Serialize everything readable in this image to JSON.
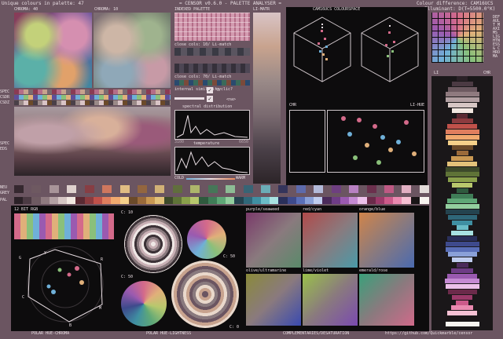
{
  "header": {
    "unique_colours": "Unique colours in palette: 47",
    "title": "= CENSOR v0.6.0 - PALETTE ANALYSER =",
    "colour_difference": "Colour difference: CAM16UCS",
    "illuminant": "Illuminant: D(T=5500.0°K)"
  },
  "top_left": {
    "chroma_40": "CHROMA: 40",
    "chroma_10": "CHROMA: 10"
  },
  "indexed_palette": {
    "title": "INDEXED PALETTE",
    "close_cols_10": "close cols: 10/ Li-match",
    "close_cols_70": "close cols: 70/ Li-match",
    "internal_similarity": "internal similarity",
    "cyclic": "cyclic?",
    "na": "<na>",
    "spectral": "spectral distribution",
    "spectral_min": "3100",
    "spectral_max": "6650",
    "temperature": "temperature",
    "cold": "COLD",
    "warm": "WARM"
  },
  "li_matr": "LI-MATR",
  "cam16": {
    "title": "CAM16UCS COLOURSPACE",
    "chr": "CHR",
    "li_hue": "LI-HUE"
  },
  "right": {
    "li": "LI",
    "chr": "CHR",
    "side_text": "DEFAULT MAXIMS LIGHTNESS & CHROMA"
  },
  "spec_labels": [
    "SPEC",
    "CSDR",
    "CSDZ",
    "SPEC",
    "EDS"
  ],
  "neu": "NEU",
  "grey": "GREY",
  "pal": "PAL",
  "bit12": "12 BIT RGB",
  "polar": {
    "c10": "C: 10",
    "c50a": "C: 50",
    "c50b": "C: 50",
    "c0": "C: 0",
    "letters": [
      "G",
      "Y",
      "R",
      "C",
      "B",
      "M"
    ]
  },
  "complements": [
    "purple/seaweed",
    "red/cyan",
    "orange/blue",
    "olive/ultramarine",
    "lime/violet",
    "emerald/rose"
  ],
  "footer": {
    "polar_hue_chroma": "POLAR HUE-CHROMA",
    "polar_hue_lightness": "POLAR HUE-LIGHTNESS",
    "complementaries": "COMPLEMENTARIES/DESATURATION",
    "url": "https://github.com/Quickmarble/censor"
  },
  "palette_colors": [
    "#2b2127",
    "#4b3a43",
    "#6e5a61",
    "#8f7a7f",
    "#b3a0a3",
    "#d6c6c4",
    "#f2e8e1",
    "#5a2a33",
    "#8c3b3f",
    "#c0514a",
    "#e07e5e",
    "#f1a96e",
    "#f5d08a",
    "#6b4a2a",
    "#9a6a3a",
    "#c99853",
    "#e3c27a",
    "#3d4a2a",
    "#5f7337",
    "#8aa04b",
    "#b8c86d",
    "#2f5a3e",
    "#3f7d57",
    "#5fa877",
    "#93cf9f",
    "#24434f",
    "#2f6779",
    "#3f8fa2",
    "#6bbcc7",
    "#a8e2e2",
    "#2a2f5a",
    "#3e4a8c",
    "#5a6fb8",
    "#8aa0d8",
    "#c0cdef",
    "#4a2a5a",
    "#6e3c86",
    "#9a5ab0",
    "#c58ad3",
    "#ecc0ea",
    "#6b2a4a",
    "#9c3a6a",
    "#cc5a8a",
    "#ea8ab0",
    "#f6c0d3",
    "#1a1517",
    "#f8f4f0"
  ]
}
